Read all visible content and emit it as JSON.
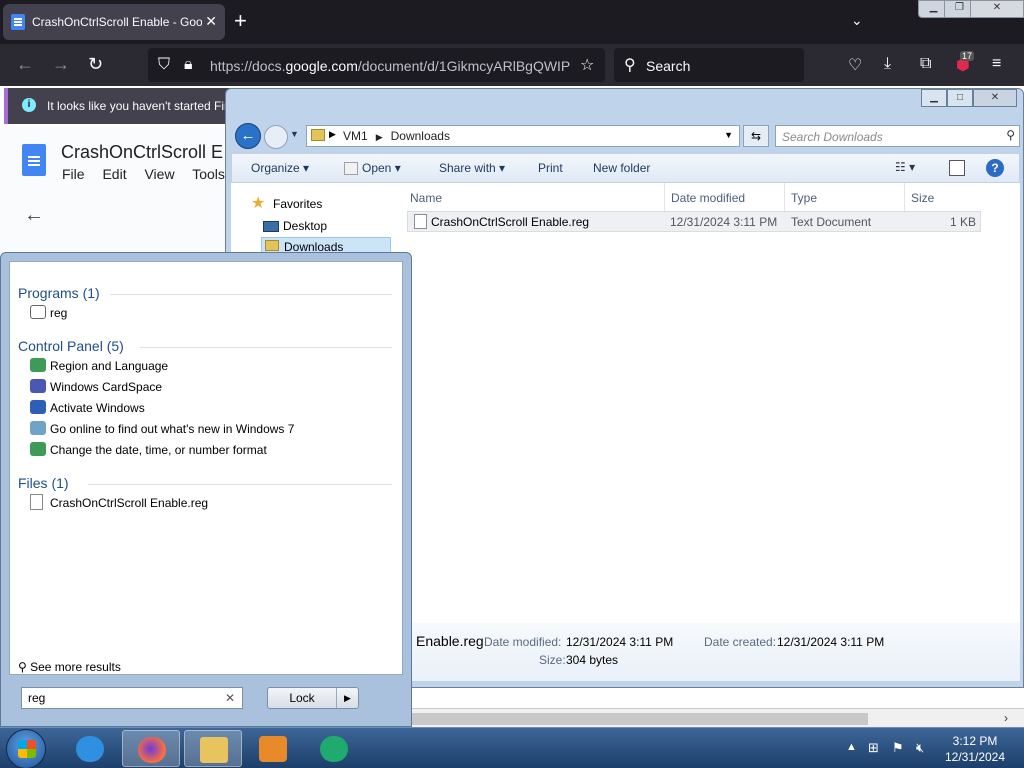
{
  "firefox": {
    "tab_title": "CrashOnCtrlScroll Enable - Goo",
    "tab_close": "✕",
    "new_tab": "+",
    "url_prefix": "https://docs.",
    "url_domain": "google.com",
    "url_path": "/document/d/1GikmcyARlBgQWIP",
    "search_label": "Search",
    "extensions_badge": "17",
    "notification": "It looks like you haven't started Fir"
  },
  "docs": {
    "title": "CrashOnCtrlScroll E",
    "menu": [
      "File",
      "Edit",
      "View",
      "Tools"
    ]
  },
  "explorer": {
    "breadcrumb": [
      "VM1",
      "Downloads"
    ],
    "search_placeholder": "Search Downloads",
    "toolbar": {
      "organize": "Organize ▾",
      "open": "Open ▾",
      "share_with": "Share with ▾",
      "print": "Print",
      "new_folder": "New folder"
    },
    "nav": {
      "favorites": "Favorites",
      "desktop": "Desktop",
      "downloads": "Downloads"
    },
    "columns": [
      "Name",
      "Date modified",
      "Type",
      "Size"
    ],
    "file": {
      "name": "CrashOnCtrlScroll Enable.reg",
      "date_modified": "12/31/2024 3:11 PM",
      "type": "Text Document",
      "size": "1 KB"
    },
    "details": {
      "name": "Enable.reg",
      "date_modified_label": "Date modified:",
      "date_modified": "12/31/2024 3:11 PM",
      "date_created_label": "Date created:",
      "date_created": "12/31/2024 3:11 PM",
      "size_label": "Size:",
      "size": "304 bytes"
    }
  },
  "start_menu": {
    "programs_header": "Programs (1)",
    "programs": [
      "reg"
    ],
    "control_panel_header": "Control Panel (5)",
    "control_panel": [
      "Region and Language",
      "Windows CardSpace",
      "Activate Windows",
      "Go online to find out what's new in Windows 7",
      "Change the date, time, or number format"
    ],
    "files_header": "Files (1)",
    "files": [
      "CrashOnCtrlScroll Enable.reg"
    ],
    "see_more": "See more results",
    "search_value": "reg",
    "lock_label": "Lock"
  },
  "taskbar": {
    "time": "3:12 PM",
    "date": "12/31/2024"
  }
}
